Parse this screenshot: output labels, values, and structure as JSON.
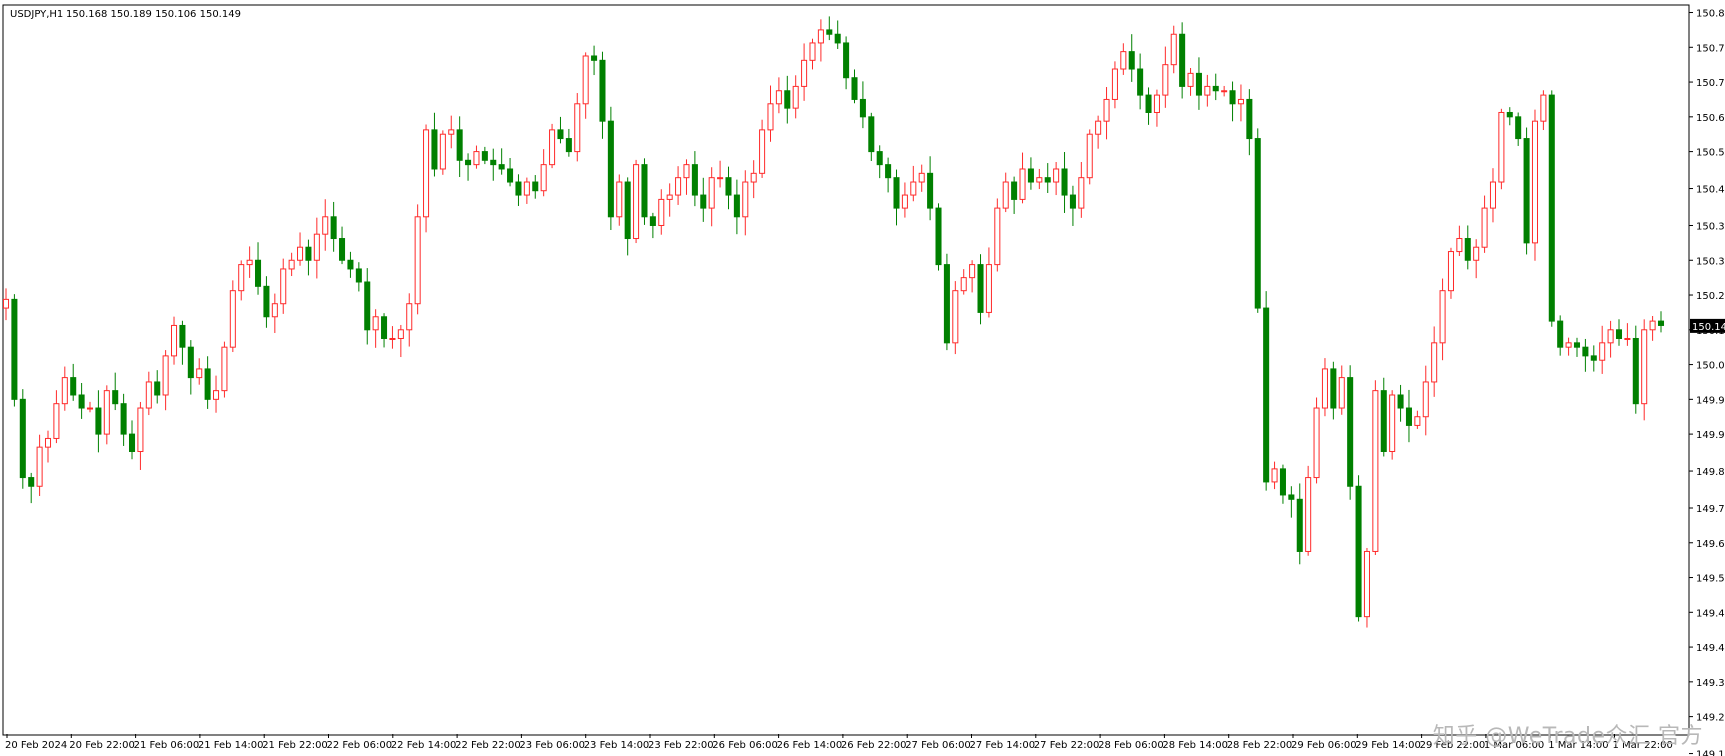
{
  "header": {
    "symbol_tf": "USDJPY,H1",
    "ohlc": "150.168 150.189 150.106 150.149"
  },
  "watermark": "知乎 @WeTrade众汇 官方",
  "chart_data": {
    "type": "candlestick",
    "title": "USDJPY,H1",
    "ylim": [
      149.21,
      150.885
    ],
    "y_ticks": [
      "150.870",
      "150.790",
      "150.710",
      "150.630",
      "150.550",
      "150.465",
      "150.380",
      "150.300",
      "150.220",
      "150.140",
      "150.060",
      "149.980",
      "149.900",
      "149.815",
      "149.730",
      "149.650",
      "149.570",
      "149.490",
      "149.410",
      "149.330",
      "149.250",
      "149.165"
    ],
    "x_ticks": [
      "20 Feb 2024",
      "20 Feb 22:00",
      "21 Feb 06:00",
      "21 Feb 14:00",
      "21 Feb 22:00",
      "22 Feb 06:00",
      "22 Feb 14:00",
      "22 Feb 22:00",
      "23 Feb 06:00",
      "23 Feb 14:00",
      "23 Feb 22:00",
      "26 Feb 06:00",
      "26 Feb 14:00",
      "26 Feb 22:00",
      "27 Feb 06:00",
      "27 Feb 14:00",
      "27 Feb 22:00",
      "28 Feb 06:00",
      "28 Feb 14:00",
      "28 Feb 22:00",
      "29 Feb 06:00",
      "29 Feb 14:00",
      "29 Feb 22:00",
      "1 Mar 06:00",
      "1 Mar 14:00",
      "1 Mar 22:00"
    ],
    "last_price": "150.149",
    "up_color": "#ff2a2a",
    "down_color": "#008000",
    "background": "#ffffff",
    "grid": false,
    "closes": [
      150.21,
      149.98,
      149.8,
      149.78,
      149.87,
      149.89,
      149.97,
      150.03,
      149.99,
      149.96,
      149.96,
      149.9,
      150.0,
      149.97,
      149.9,
      149.86,
      149.96,
      150.02,
      149.99,
      150.08,
      150.15,
      150.1,
      150.03,
      150.05,
      149.98,
      150.0,
      150.1,
      150.23,
      150.29,
      150.3,
      150.24,
      150.17,
      150.2,
      150.28,
      150.3,
      150.33,
      150.3,
      150.36,
      150.4,
      150.35,
      150.3,
      150.28,
      150.25,
      150.14,
      150.17,
      150.12,
      150.12,
      150.14,
      150.2,
      150.4,
      150.6,
      150.51,
      150.59,
      150.6,
      150.53,
      150.52,
      150.55,
      150.53,
      150.52,
      150.51,
      150.48,
      150.45,
      150.48,
      150.46,
      150.52,
      150.6,
      150.58,
      150.55,
      150.66,
      150.77,
      150.76,
      150.62,
      150.4,
      150.48,
      150.35,
      150.52,
      150.4,
      150.38,
      150.44,
      150.45,
      150.49,
      150.52,
      150.45,
      150.42,
      150.49,
      150.49,
      150.45,
      150.4,
      150.48,
      150.5,
      150.6,
      150.66,
      150.69,
      150.65,
      150.7,
      150.76,
      150.8,
      150.83,
      150.82,
      150.8,
      150.72,
      150.67,
      150.63,
      150.55,
      150.52,
      150.49,
      150.42,
      150.45,
      150.48,
      150.5,
      150.42,
      150.29,
      150.11,
      150.23,
      150.26,
      150.29,
      150.18,
      150.29,
      150.42,
      150.48,
      150.44,
      150.51,
      150.48,
      150.49,
      150.48,
      150.51,
      150.45,
      150.42,
      150.49,
      150.59,
      150.62,
      150.67,
      150.74,
      150.78,
      150.74,
      150.68,
      150.64,
      150.68,
      150.75,
      150.82,
      150.7,
      150.73,
      150.68,
      150.7,
      150.69,
      150.69,
      150.66,
      150.67,
      150.58,
      150.19,
      149.79,
      149.82,
      149.76,
      149.75,
      149.63,
      149.8,
      149.96,
      150.05,
      149.96,
      150.03,
      149.78,
      149.48,
      149.63,
      150.0,
      149.86,
      149.99,
      149.96,
      149.92,
      149.94,
      150.02,
      150.11,
      150.23,
      150.32,
      150.35,
      150.3,
      150.33,
      150.42,
      150.48,
      150.64,
      150.63,
      150.58,
      150.34,
      150.62,
      150.68,
      150.16,
      150.1,
      150.11,
      150.1,
      150.08,
      150.07,
      150.11,
      150.14,
      150.12,
      150.12,
      149.97,
      150.14,
      150.16,
      150.15
    ]
  }
}
